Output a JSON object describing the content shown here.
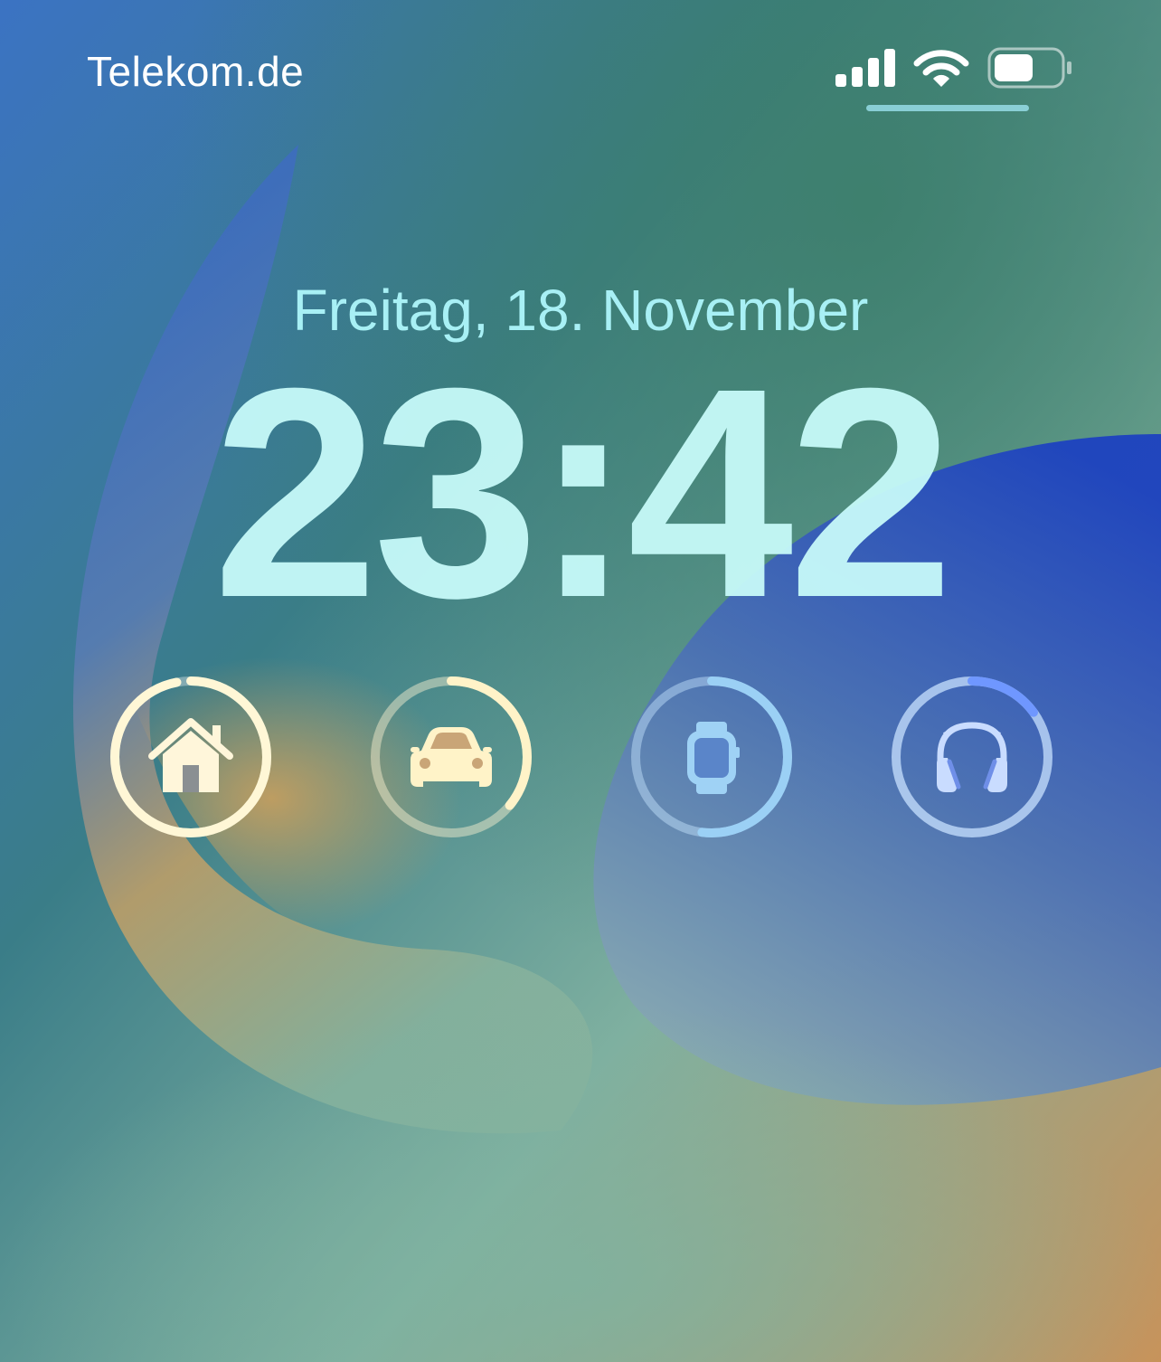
{
  "status_bar": {
    "carrier": "Telekom.de",
    "icons": [
      "signal-bars-icon",
      "wifi-icon",
      "battery-icon"
    ],
    "battery_level": 0.6
  },
  "lock_screen": {
    "date": "Freitag, 18. November",
    "time": "23:42"
  },
  "widgets": [
    {
      "icon": "home-icon",
      "label": "Home",
      "level": 0.97,
      "color": "#fff7d6"
    },
    {
      "icon": "car-icon",
      "label": "Car",
      "level": 0.36,
      "color": "#fff3c8"
    },
    {
      "icon": "watch-icon",
      "label": "Watch",
      "level": 0.52,
      "color": "#9bd0f5"
    },
    {
      "icon": "headphones-icon",
      "label": "Headphones",
      "level": 0.15,
      "color": "#6f97ff"
    }
  ],
  "colors": {
    "date": "#a8f0f5",
    "time": "#c8fbfa"
  }
}
